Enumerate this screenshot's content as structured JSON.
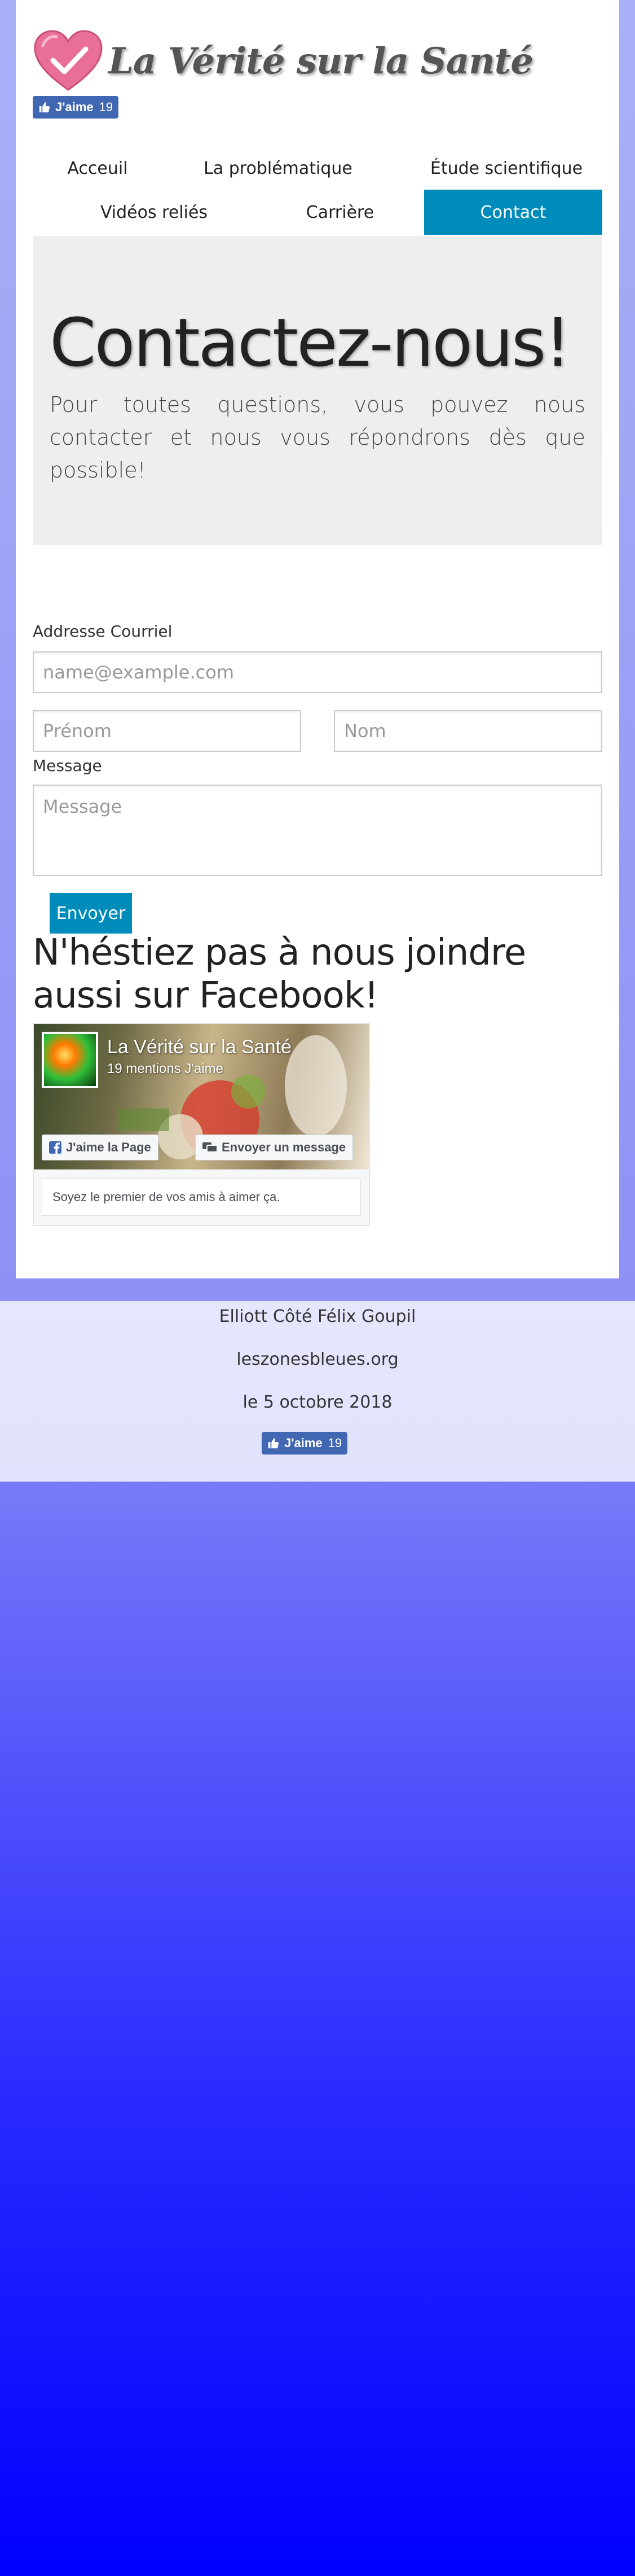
{
  "site": {
    "title": "La Vérité sur la Santé",
    "like_label": "J'aime",
    "like_count": "19"
  },
  "nav": {
    "items": [
      {
        "label": "Acceuil"
      },
      {
        "label": "La problématique"
      },
      {
        "label": "Étude scientifique"
      },
      {
        "label": "Vidéos reliés"
      },
      {
        "label": "Carrière"
      },
      {
        "label": "Contact",
        "active": true
      }
    ]
  },
  "hero": {
    "title": "Contactez-nous!",
    "text": "Pour toutes questions, vous pouvez nous contacter et nous vous répondrons dès que possible!"
  },
  "form": {
    "email_label": "Addresse Courriel",
    "email_placeholder": "name@example.com",
    "firstname_placeholder": "Prénom",
    "lastname_placeholder": "Nom",
    "message_label": "Message",
    "message_placeholder": "Message",
    "submit_label": "Envoyer"
  },
  "facebook": {
    "heading": "N'héstiez pas à nous joindre aussi sur Facebook!",
    "page_name": "La Vérité sur la Santé",
    "mentions": "19 mentions J'aime",
    "like_page_label": "J'aime la Page",
    "message_label": "Envoyer un message",
    "friends_text": "Soyez le premier de vos amis à aimer ça."
  },
  "footer": {
    "authors": "Elliott Côté Félix Goupil",
    "website": "leszonesbleues.org",
    "date": "le 5 octobre 2018"
  },
  "colors": {
    "accent": "#008cba",
    "facebook": "#4267b2",
    "heart": "#ea6f98"
  }
}
